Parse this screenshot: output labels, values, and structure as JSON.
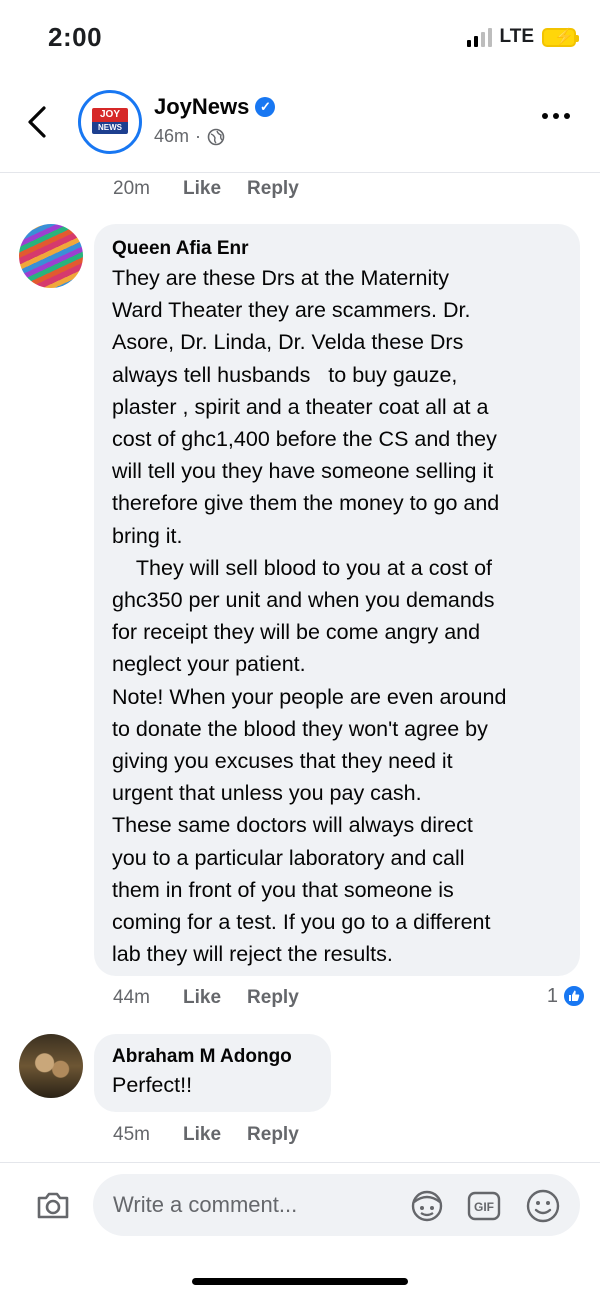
{
  "status_bar": {
    "time": "2:00",
    "network": "LTE"
  },
  "header": {
    "page_name": "JoyNews",
    "post_age": "46m",
    "post_separator": "·",
    "logo_top": "JOY",
    "logo_bottom": "NEWS"
  },
  "previous_actions": {
    "time": "20m",
    "like": "Like",
    "reply": "Reply"
  },
  "comments": [
    {
      "author": "Queen Afia Enr",
      "text": "They are these Drs at the Maternity\nWard Theater they are scammers. Dr.\nAsore, Dr. Linda, Dr. Velda these Drs\nalways tell husbands   to buy gauze,\nplaster , spirit and a theater coat all at a\ncost of ghc1,400 before the CS and they\nwill tell you they have someone selling it\ntherefore give them the money to go and\nbring it.\n    They will sell blood to you at a cost of\nghc350 per unit and when you demands\nfor receipt they will be come angry and\nneglect your patient.\nNote! When your people are even around\nto donate the blood they won't agree by\ngiving you excuses that they need it\nurgent that unless you pay cash.\nThese same doctors will always direct\nyou to a particular laboratory and call\nthem in front of you that someone is\ncoming for a test. If you go to a different\nlab they will reject the results.",
      "time": "44m",
      "like": "Like",
      "reply": "Reply",
      "reaction_count": "1"
    },
    {
      "author": "Abraham M Adongo",
      "text": "Perfect!!",
      "time": "45m",
      "like": "Like",
      "reply": "Reply"
    }
  ],
  "composer": {
    "placeholder": "Write a comment..."
  },
  "colors": {
    "accent": "#1877f2",
    "bubble": "#f0f2f5",
    "meta": "#65676b"
  }
}
